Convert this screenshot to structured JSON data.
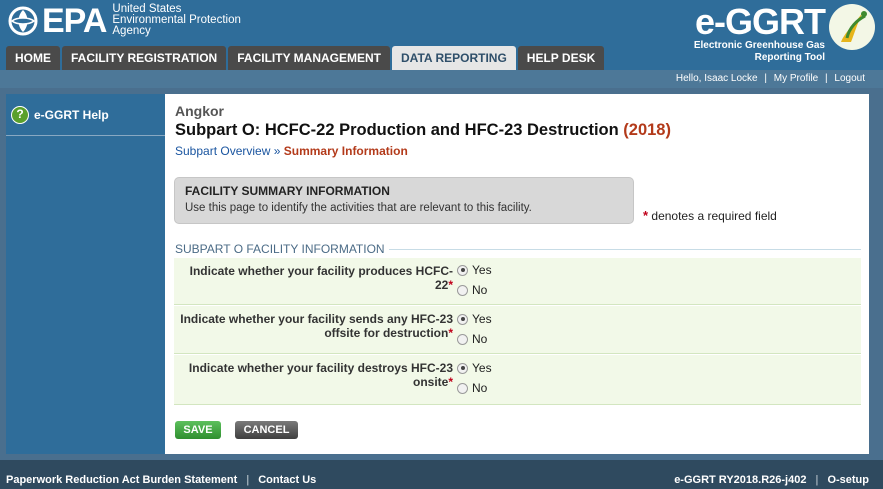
{
  "header": {
    "epa_word": "EPA",
    "agency_lines": [
      "United States",
      "Environmental Protection",
      "Agency"
    ],
    "app_title": "e-GGRT",
    "app_sub_lines": [
      "Electronic Greenhouse Gas",
      "Reporting Tool"
    ]
  },
  "tabs": [
    {
      "label": "HOME",
      "active": false
    },
    {
      "label": "FACILITY REGISTRATION",
      "active": false
    },
    {
      "label": "FACILITY MANAGEMENT",
      "active": false
    },
    {
      "label": "DATA REPORTING",
      "active": true
    },
    {
      "label": "HELP DESK",
      "active": false
    }
  ],
  "userbar": {
    "greeting": "Hello, Isaac Locke",
    "profile": "My Profile",
    "logout": "Logout"
  },
  "sidebar": {
    "help_label": "e-GGRT Help",
    "help_icon": "question-circle-icon"
  },
  "page": {
    "facility": "Angkor",
    "title": "Subpart O: HCFC-22 Production and HFC-23 Destruction",
    "year": "(2018)",
    "breadcrumb_overview": "Subpart Overview",
    "breadcrumb_sep": "»",
    "breadcrumb_current": "Summary Information"
  },
  "summary": {
    "heading": "FACILITY SUMMARY INFORMATION",
    "text": "Use this page to identify the activities that are relevant to this facility.",
    "required_note": "denotes a required field",
    "required_star": "*"
  },
  "section": {
    "legend": "SUBPART O FACILITY INFORMATION",
    "questions": [
      {
        "label": "Indicate whether your facility produces HCFC-22",
        "yes": "Yes",
        "no": "No",
        "selected": "Yes"
      },
      {
        "label": "Indicate whether your facility sends any HFC-23 offsite for destruction",
        "yes": "Yes",
        "no": "No",
        "selected": "Yes"
      },
      {
        "label": "Indicate whether your facility destroys HFC-23 onsite",
        "yes": "Yes",
        "no": "No",
        "selected": "Yes"
      }
    ]
  },
  "buttons": {
    "save": "SAVE",
    "cancel": "CANCEL"
  },
  "footer": {
    "paperwork": "Paperwork Reduction Act Burden Statement",
    "contact": "Contact Us",
    "version": "e-GGRT RY2018.R26-j402",
    "osetup": "O-setup"
  },
  "colors": {
    "header_blue": "#2f6d9a",
    "year_red": "#b33a1a",
    "required_red": "#c0001a",
    "save_green": "#3aa03a"
  }
}
